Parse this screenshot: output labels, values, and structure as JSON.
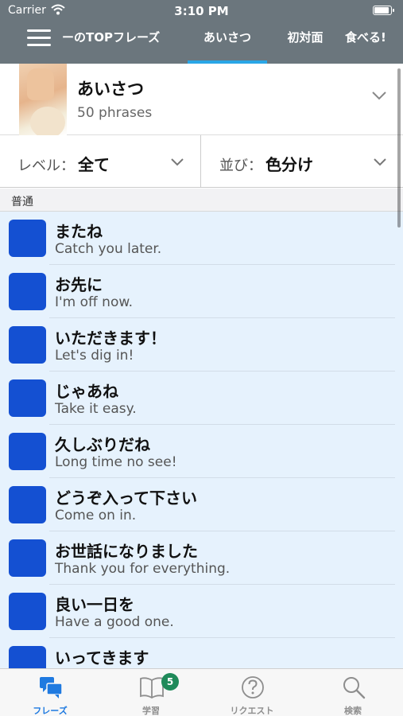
{
  "status_bar": {
    "carrier": "Carrier",
    "time": "3:10 PM"
  },
  "nav": {
    "tabs": [
      {
        "label": "ーのTOPフレーズ"
      },
      {
        "label": "あいさつ",
        "active": true
      },
      {
        "label": "初対面"
      },
      {
        "label": "食べる!"
      }
    ]
  },
  "category": {
    "title": "あいさつ",
    "count": "50 phrases"
  },
  "filters": {
    "level": {
      "label": "レベル：",
      "value": "全て"
    },
    "sort": {
      "label": "並び：",
      "value": "色分け"
    }
  },
  "section": {
    "title": "普通"
  },
  "phrases": [
    {
      "jp": "またね",
      "en": "Catch you later."
    },
    {
      "jp": "お先に",
      "en": "I'm off now."
    },
    {
      "jp": "いただきます！",
      "en": "Let's dig in!"
    },
    {
      "jp": "じゃあね",
      "en": "Take it easy."
    },
    {
      "jp": "久しぶりだね",
      "en": "Long time no see!"
    },
    {
      "jp": "どうぞ入って下さい",
      "en": "Come on in."
    },
    {
      "jp": "お世話になりました",
      "en": "Thank you for everything."
    },
    {
      "jp": "良い一日を",
      "en": "Have a good one."
    },
    {
      "jp": "いってきます",
      "en": ""
    }
  ],
  "tab_bar": {
    "items": [
      {
        "label": "フレーズ",
        "icon": "phrases-icon",
        "active": true
      },
      {
        "label": "学習",
        "icon": "book-icon",
        "badge": "5"
      },
      {
        "label": "リクエスト",
        "icon": "question-icon"
      },
      {
        "label": "検索",
        "icon": "search-icon"
      }
    ]
  },
  "colors": {
    "header": "#6b767d",
    "tab_underline": "#2aa6e6",
    "list_background": "#e6f2fd",
    "phrase_badge": "#1450d2",
    "active_tab": "#1f7ae0",
    "learn_badge": "#1f8a5a"
  }
}
